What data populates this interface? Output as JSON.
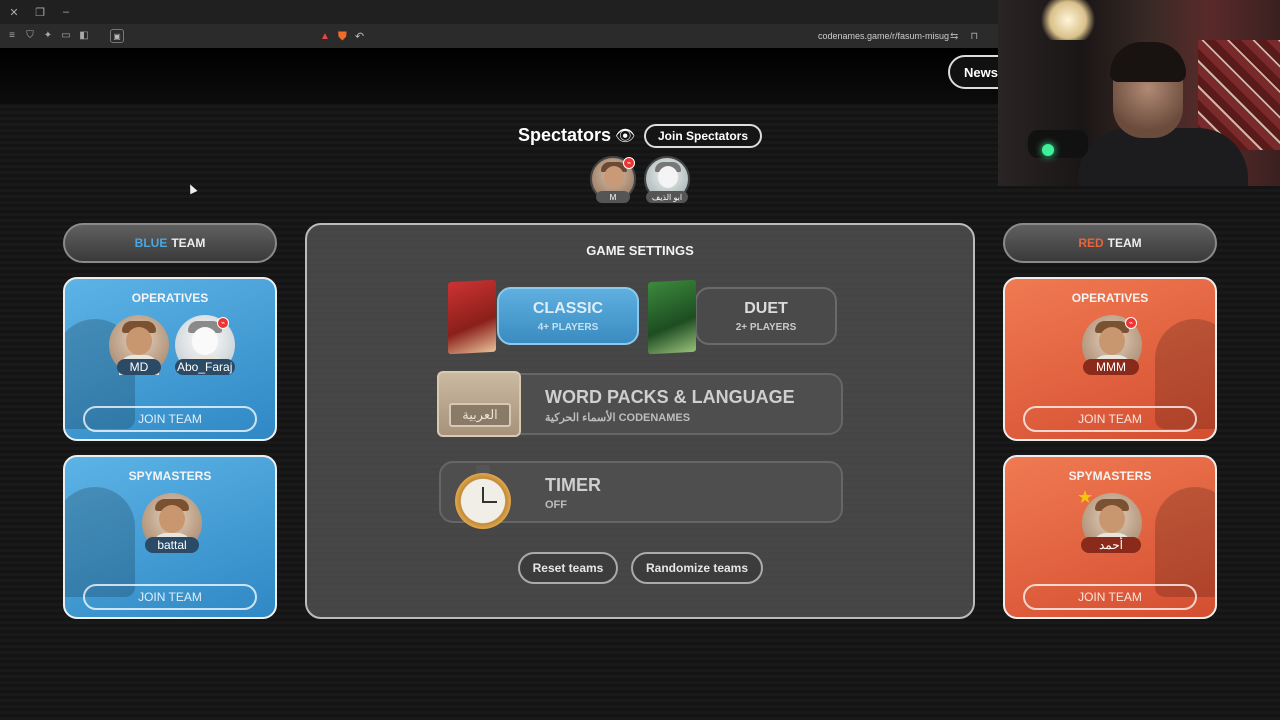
{
  "browser": {
    "url": "codenames.game/r/fasum-misug"
  },
  "header": {
    "news_label": "News"
  },
  "spectators": {
    "title": "Spectators",
    "join_label": "Join Spectators",
    "members": [
      {
        "name": "M"
      },
      {
        "name": "ابو الذيف"
      }
    ]
  },
  "blue_team": {
    "color_word": "BLUE",
    "team_word": "TEAM",
    "accent": "#4aa7e0",
    "operatives": {
      "title": "OPERATIVES",
      "players": [
        "MD",
        "Abo_Faraj"
      ],
      "join_label": "JOIN TEAM"
    },
    "spymasters": {
      "title": "SPYMASTERS",
      "players": [
        "battal"
      ],
      "join_label": "JOIN TEAM"
    }
  },
  "red_team": {
    "color_word": "RED",
    "team_word": "TEAM",
    "accent": "#e8643c",
    "operatives": {
      "title": "OPERATIVES",
      "players": [
        "MMM"
      ],
      "join_label": "JOIN TEAM"
    },
    "spymasters": {
      "title": "SPYMASTERS",
      "players": [
        "أحمد"
      ],
      "join_label": "JOIN TEAM"
    }
  },
  "settings": {
    "title": "GAME SETTINGS",
    "modes": [
      {
        "name": "CLASSIC",
        "players": "4+ PLAYERS",
        "selected": true
      },
      {
        "name": "DUET",
        "players": "2+ PLAYERS",
        "selected": false
      }
    ],
    "word_packs": {
      "title": "WORD PACKS & LANGUAGE",
      "subtitle": "الأسماء الحركية CODENAMES",
      "tile_text": "العربية"
    },
    "timer": {
      "title": "TIMER",
      "value": "OFF"
    },
    "reset_label": "Reset teams",
    "randomize_label": "Randomize teams"
  }
}
